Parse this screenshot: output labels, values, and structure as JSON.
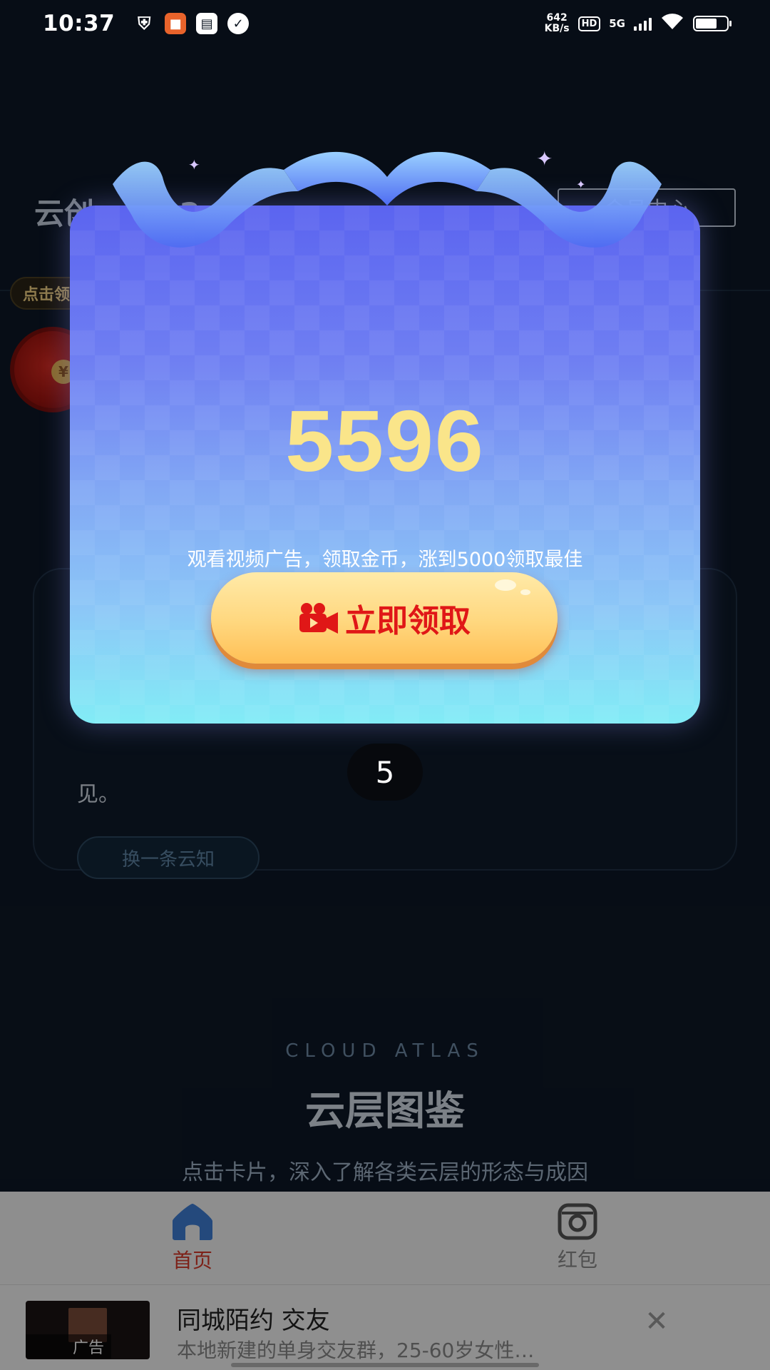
{
  "status_bar": {
    "time": "10:37",
    "speed_value": "642",
    "speed_unit": "KB/s",
    "hd": "HD",
    "network": "5G",
    "icons": [
      "shield-icon",
      "app-notification-icon",
      "inbox-icon",
      "check-icon",
      "wifi-icon",
      "battery-icon"
    ]
  },
  "background_page": {
    "title_prefix": "云创",
    "title_suffix": "2",
    "member_center": "会员中心",
    "tip_bubble": "点击领",
    "card_text": "见。",
    "card_refresh": "换一条云知",
    "atlas_en": "CLOUD ATLAS",
    "atlas_cn": "云层图鉴",
    "atlas_desc": "点击卡片，深入了解各类云层的形态与成因"
  },
  "modal": {
    "amount": "5596",
    "description": "观看视频广告，领取金币，涨到5000领取最佳",
    "claim_label": "立即领取",
    "claim_icon": "video-camera-icon"
  },
  "countdown": "5",
  "bottom_nav": {
    "items": [
      {
        "label": "首页",
        "icon": "home-icon",
        "active": true
      },
      {
        "label": "红包",
        "icon": "red-packet-icon",
        "active": false
      }
    ]
  },
  "ad": {
    "title": "同城陌约 交友",
    "description": "本地新建的单身交友群，25-60岁女性…",
    "label": "广告",
    "close_icon": "close-icon"
  },
  "colors": {
    "amount": "#fae58a",
    "claim_text": "#e01717",
    "nav_active": "#d83a2a",
    "page_bg": "#0d1826"
  }
}
